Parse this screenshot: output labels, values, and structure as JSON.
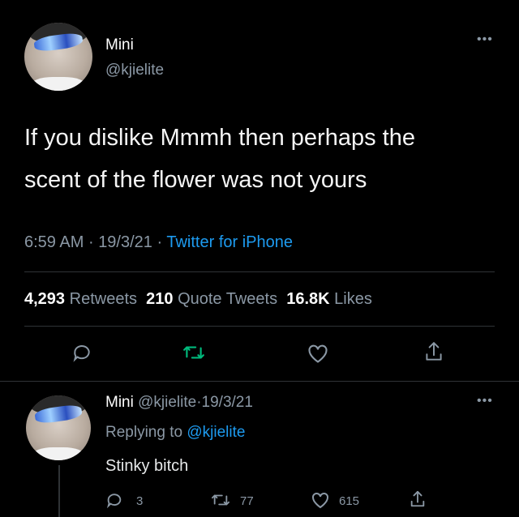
{
  "main_tweet": {
    "author_name": "Mini",
    "author_handle": "@kjielite",
    "more_icon": "more-horizontal-icon",
    "text_line1": "If you dislike Mmmh then perhaps the",
    "text_line2": "scent of the flower was not yours",
    "time": "6:59 AM",
    "date": "19/3/21",
    "separator": "·",
    "source": "Twitter for iPhone",
    "retweets_count": "4,293",
    "retweets_label": "Retweets",
    "quotes_count": "210",
    "quotes_label": "Quote Tweets",
    "likes_count": "16.8K",
    "likes_label": "Likes",
    "actions": [
      "reply-icon",
      "retweet-icon",
      "like-icon",
      "share-icon"
    ]
  },
  "reply": {
    "author_name": "Mini",
    "author_handle": "@kjielite",
    "separator": "·",
    "date": "19/3/21",
    "replying_prefix": "Replying to",
    "replying_handle": "@kjielite",
    "text": "Stinky bitch",
    "reply_count": "3",
    "retweet_count": "77",
    "like_count": "615"
  },
  "colors": {
    "background": "#000000",
    "link": "#1d9bf0",
    "retweet_active": "#00ba7c",
    "muted": "#8b98a5"
  }
}
